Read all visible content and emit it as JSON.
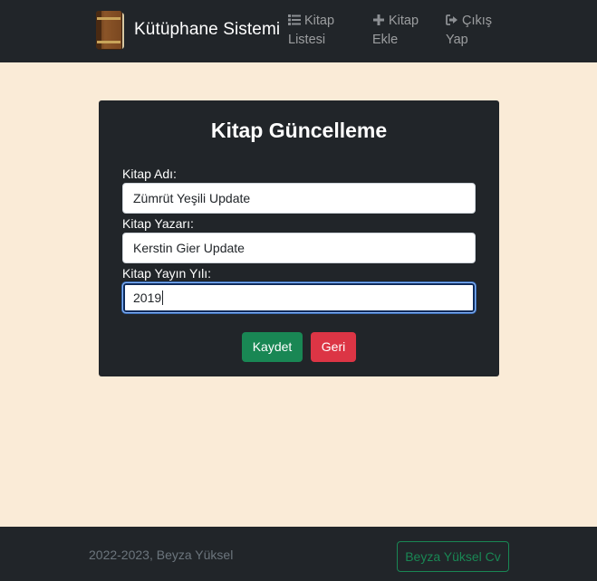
{
  "navbar": {
    "brand": "Kütüphane Sistemi",
    "brand_icon": "book-icon",
    "links": [
      {
        "line1": "Kitap",
        "line2": "Listesi",
        "icon": "list-icon"
      },
      {
        "line1": "Kitap",
        "line2": "Ekle",
        "icon": "plus-icon"
      },
      {
        "line1": "Çıkış",
        "line2": "Yap",
        "icon": "sign-out-icon"
      }
    ]
  },
  "form": {
    "title": "Kitap Güncelleme",
    "fields": [
      {
        "label": "Kitap Adı:",
        "value": "Zümrüt Yeşili Update"
      },
      {
        "label": "Kitap Yazarı:",
        "value": "Kerstin Gier Update"
      },
      {
        "label": "Kitap Yayın Yılı:",
        "value": "2019"
      }
    ],
    "save_label": "Kaydet",
    "back_label": "Geri"
  },
  "footer": {
    "copyright": "2022-2023, Beyza Yüksel",
    "cv_label": "Beyza Yüksel Cv"
  },
  "colors": {
    "page_bg": "#faebd7",
    "dark": "#212529",
    "success": "#198754",
    "danger": "#dc3545",
    "nav_text": "#8c8f93",
    "muted": "#6c757d"
  }
}
